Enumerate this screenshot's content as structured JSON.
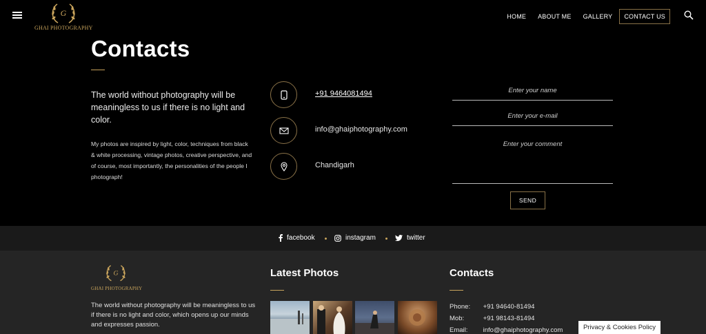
{
  "brand": {
    "logo_text": "GHAI PHOTOGRAPHY",
    "accent_color": "#c9a45c"
  },
  "header": {
    "menu_icon": "hamburger-menu-icon",
    "nav": [
      "HOME",
      "ABOUT ME",
      "GALLERY",
      "CONTACT US"
    ],
    "active_nav": "CONTACT US",
    "search_icon": "search-icon"
  },
  "main": {
    "title": "Contacts",
    "lead": "The world without photography will be meaningless to us if there is no light and color.",
    "description": "My photos are inspired by light, color, techniques from black & white processing, vintage photos, creative perspective, and of course, most importantly, the personalities of the people I photograph!",
    "contacts": [
      {
        "icon": "phone-icon",
        "text": "+91 9464081494"
      },
      {
        "icon": "mail-icon",
        "text": "info@ghaiphotography.com"
      },
      {
        "icon": "location-pin-icon",
        "text": "Chandigarh"
      }
    ],
    "form": {
      "name_placeholder": "Enter your name",
      "email_placeholder": "Enter your e-mail",
      "comment_placeholder": "Enter your comment",
      "send_label": "SEND"
    }
  },
  "social": [
    {
      "icon": "facebook-icon",
      "label": "facebook"
    },
    {
      "icon": "instagram-icon",
      "label": "instagram"
    },
    {
      "icon": "twitter-icon",
      "label": "twitter"
    }
  ],
  "footer": {
    "text": "The world without photography will be meaningless to us if there is no light and color, which opens up our minds and expresses passion.",
    "latest_photos_heading": "Latest Photos",
    "contacts_heading": "Contacts",
    "contacts": [
      {
        "label": "Phone:",
        "value": "+91 94640-81494"
      },
      {
        "label": "Mob:",
        "value": "+91 98143-81494"
      },
      {
        "label": "Email:",
        "value": "info@ghaiphotography.com"
      }
    ]
  },
  "privacy_label": "Privacy & Cookies Policy"
}
